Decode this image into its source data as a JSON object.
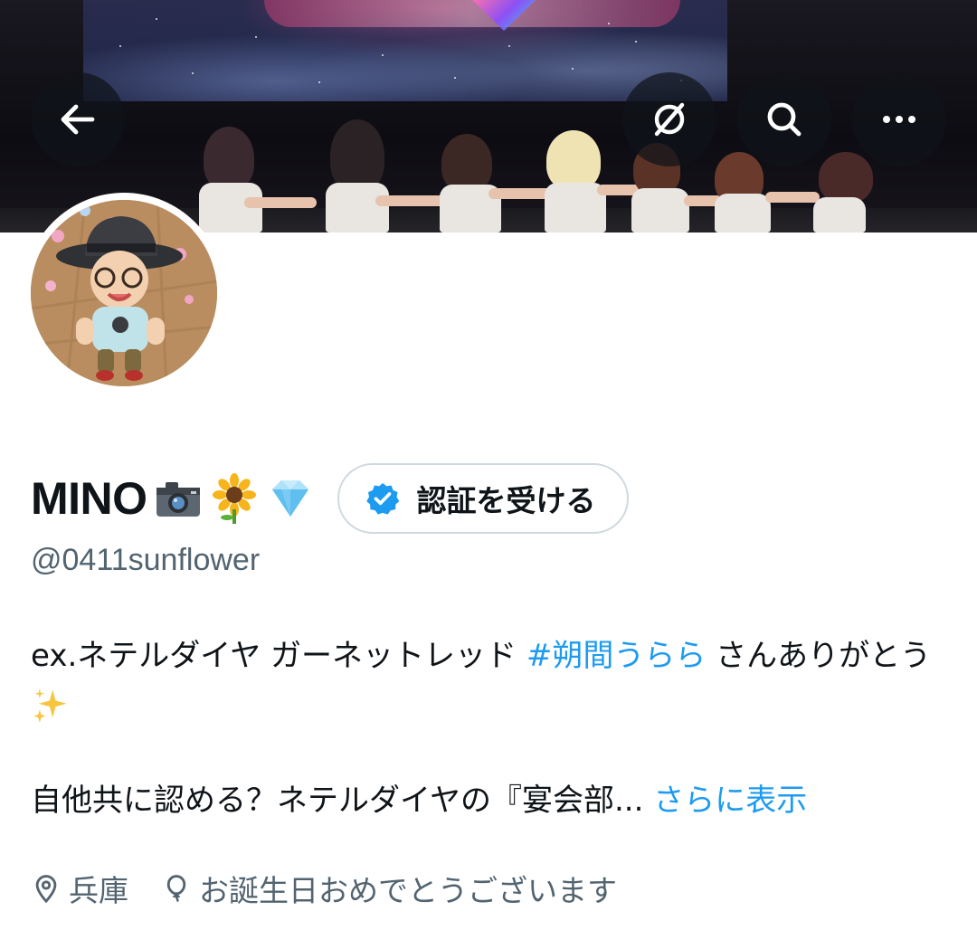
{
  "banner": {
    "alt_description": ""
  },
  "nav": {
    "back_icon": "arrow-left-icon",
    "hide_icon": "eye-off-circle-icon",
    "search_icon": "search-icon",
    "more_icon": "more-horizontal-icon"
  },
  "profile": {
    "display_name": "MINO",
    "name_emojis": [
      "camera-icon",
      "sunflower-icon",
      "diamond-icon"
    ],
    "verify_label": "認証を受ける",
    "handle": "@0411sunflower",
    "bio_line1_pre": "ex.ネテルダイヤ ガーネットレッド ",
    "bio_hashtag": "#朔間うらら",
    "bio_line1_post": " さんありがとう",
    "bio_line2": "自他共に認める？ネテルダイヤの『宴会部...",
    "show_more": "さらに表示",
    "location": "兵庫",
    "birthday_text": "お誕生日おめでとうございます"
  },
  "colors": {
    "accent": "#1d9bf0",
    "secondary_text": "#536471",
    "primary_text": "#0f1419",
    "button_border": "#cfd9de"
  }
}
